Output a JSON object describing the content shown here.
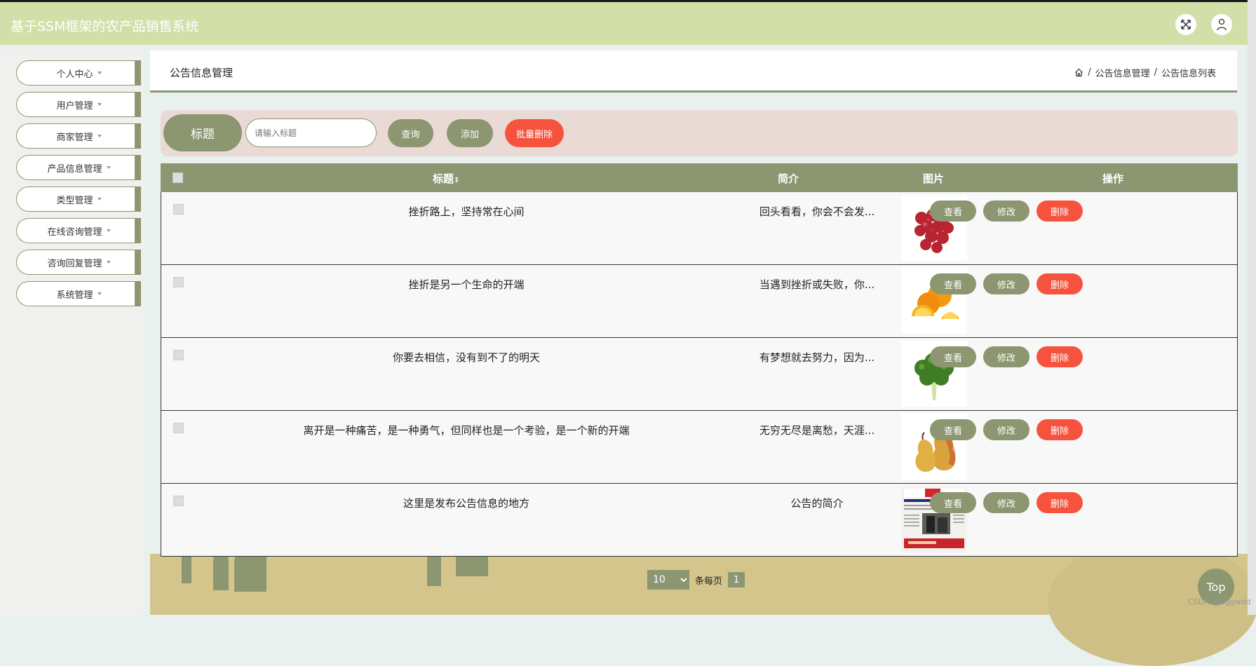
{
  "app": {
    "title": "基于SSM框架的农产品销售系统"
  },
  "sidebar": {
    "items": [
      {
        "label": "个人中心"
      },
      {
        "label": "用户管理"
      },
      {
        "label": "商家管理"
      },
      {
        "label": "产品信息管理"
      },
      {
        "label": "类型管理"
      },
      {
        "label": "在线咨询管理"
      },
      {
        "label": "咨询回复管理"
      },
      {
        "label": "系统管理"
      }
    ]
  },
  "header": {
    "title": "公告信息管理",
    "breadcrumb": [
      "公告信息管理",
      "公告信息列表"
    ]
  },
  "search": {
    "label": "标题",
    "placeholder": "请输入标题",
    "query_label": "查询",
    "add_label": "添加",
    "batch_delete_label": "批量删除"
  },
  "table": {
    "headers": {
      "title": "标题",
      "intro": "简介",
      "image": "图片",
      "actions": "操作"
    },
    "rows": [
      {
        "title": "挫折路上，坚持常在心间",
        "intro": "回头看看，你会不会发...",
        "image": "grapes"
      },
      {
        "title": "挫折是另一个生命的开端",
        "intro": "当遇到挫折或失败，你...",
        "image": "oranges"
      },
      {
        "title": "你要去相信，没有到不了的明天",
        "intro": "有梦想就去努力，因为...",
        "image": "lettuce"
      },
      {
        "title": "离开是一种痛苦，是一种勇气，但同样也是一个考验，是一个新的开端",
        "intro": "无穷无尽是离愁，天涯...",
        "image": "pears"
      },
      {
        "title": "这里是发布公告信息的地方",
        "intro": "公告的简介",
        "image": "newspaper"
      }
    ],
    "actions": {
      "view": "查看",
      "edit": "修改",
      "delete": "删除"
    }
  },
  "pagination": {
    "page_size": "10",
    "per_page_label": "条每页",
    "current_page": "1"
  },
  "top_button": "Top",
  "watermark": "CSDN @eggwdd",
  "colors": {
    "accent": "#8c9670",
    "danger": "#f5533d",
    "topbar": "#d3dfa8"
  }
}
